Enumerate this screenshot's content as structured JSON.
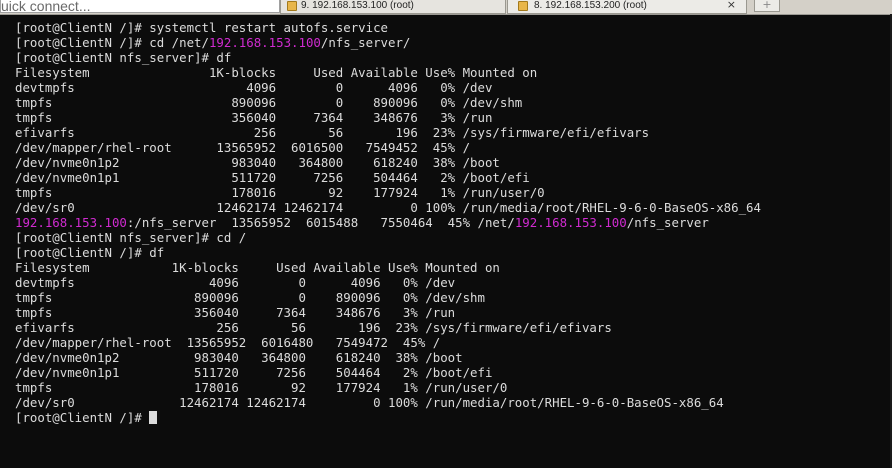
{
  "topbar": {
    "quick_connect_label": "uick connect...",
    "tabs": [
      {
        "label": "9. 192.168.153.100 (root)",
        "close": ""
      },
      {
        "label": "8. 192.168.153.200 (root)",
        "close": "×"
      }
    ],
    "new_tab_symbol": "+"
  },
  "colors": {
    "background": "#0c0c0c",
    "text": "#dcdcdc",
    "ip_highlight": "#d02bd0"
  },
  "terminal": {
    "lines": [
      "[root@ClientN /]# systemctl restart autofs.service",
      [
        "[root@ClientN /]# cd /net/",
        "192.168.153.100",
        "/nfs_server/"
      ],
      "[root@ClientN nfs_server]# df",
      "Filesystem                1K-blocks     Used Available Use% Mounted on",
      "devtmpfs                       4096        0      4096   0% /dev",
      "tmpfs                        890096        0    890096   0% /dev/shm",
      "tmpfs                        356040     7364    348676   3% /run",
      "efivarfs                        256       56       196  23% /sys/firmware/efi/efivars",
      "/dev/mapper/rhel-root      13565952  6016500   7549452  45% /",
      "/dev/nvme0n1p2               983040   364800    618240  38% /boot",
      "/dev/nvme0n1p1               511720     7256    504464   2% /boot/efi",
      "tmpfs                        178016       92    177924   1% /run/user/0",
      "/dev/sr0                   12462174 12462174         0 100% /run/media/root/RHEL-9-6-0-BaseOS-x86_64",
      [
        "",
        "192.168.153.100",
        ":/nfs_server  13565952  6015488   7550464  45% /net/",
        "192.168.153.100",
        "/nfs_server"
      ],
      "[root@ClientN nfs_server]# cd /",
      "[root@ClientN /]# df",
      "Filesystem           1K-blocks     Used Available Use% Mounted on",
      "devtmpfs                  4096        0      4096   0% /dev",
      "tmpfs                   890096        0    890096   0% /dev/shm",
      "tmpfs                   356040     7364    348676   3% /run",
      "efivarfs                   256       56       196  23% /sys/firmware/efi/efivars",
      "/dev/mapper/rhel-root  13565952  6016480   7549472  45% /",
      "/dev/nvme0n1p2          983040   364800    618240  38% /boot",
      "/dev/nvme0n1p1          511720     7256    504464   2% /boot/efi",
      "tmpfs                   178016       92    177924   1% /run/user/0",
      "/dev/sr0              12462174 12462174         0 100% /run/media/root/RHEL-9-6-0-BaseOS-x86_64",
      "[root@ClientN /]#"
    ]
  }
}
